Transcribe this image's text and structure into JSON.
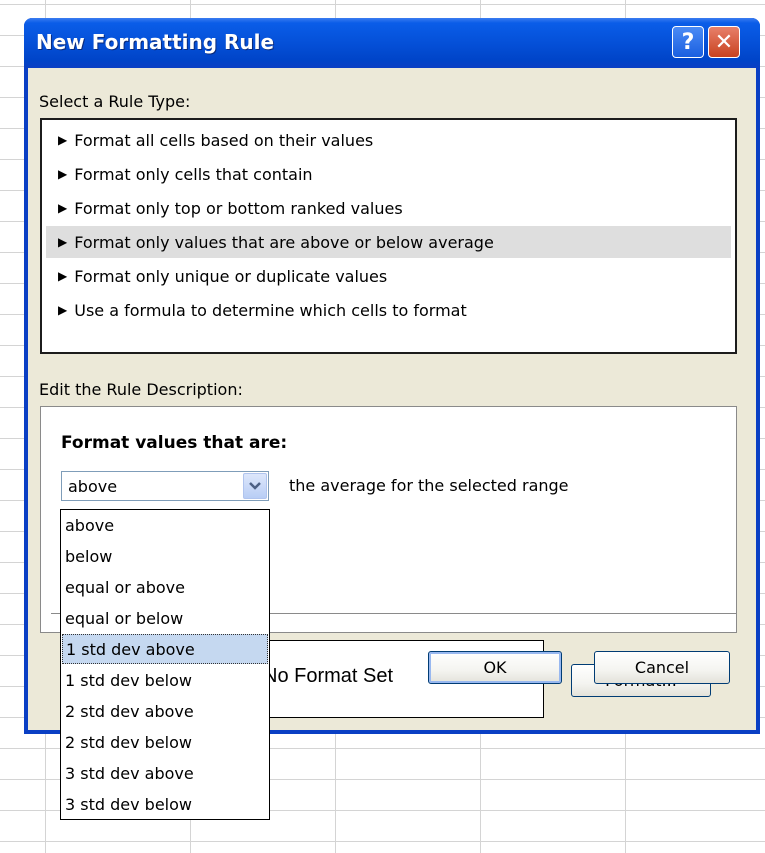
{
  "dialog": {
    "title": "New Formatting Rule",
    "help_glyph": "?",
    "close_glyph": "✕"
  },
  "rule_type": {
    "label": "Select a Rule Type:",
    "items": [
      {
        "label": "Format all cells based on their values"
      },
      {
        "label": "Format only cells that contain"
      },
      {
        "label": "Format only top or bottom ranked values"
      },
      {
        "label": "Format only values that are above or below average",
        "selected": true
      },
      {
        "label": "Format only unique or duplicate values"
      },
      {
        "label": "Use a formula to determine which cells to format"
      }
    ]
  },
  "description": {
    "label": "Edit the Rule Description:",
    "heading": "Format values that are:",
    "combo_value": "above",
    "combo_suffix": "the average for the selected range",
    "preview_text": "No Format Set",
    "format_button": "Format..."
  },
  "buttons": {
    "ok": "OK",
    "cancel": "Cancel"
  },
  "dropdown": {
    "options": [
      "above",
      "below",
      "equal or above",
      "equal or below",
      "1 std dev above",
      "1 std dev below",
      "2 std dev above",
      "2 std dev below",
      "3 std dev above",
      "3 std dev below"
    ],
    "hovered": "1 std dev above"
  },
  "colors": {
    "titlebar": "#0550d8",
    "dialog_face": "#ece9d8",
    "selected_rule": "#dedede",
    "hover_option": "#c5d8f0"
  }
}
